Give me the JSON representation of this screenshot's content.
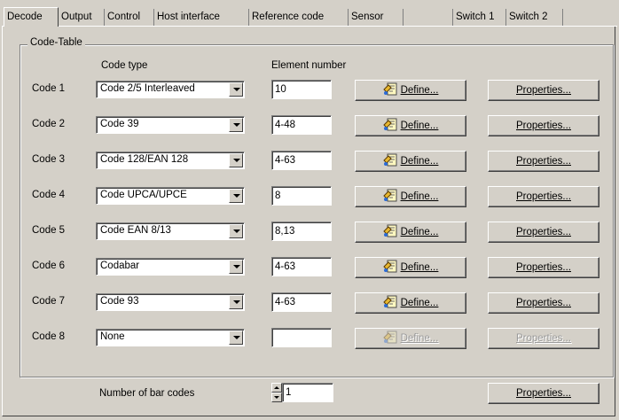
{
  "tabs": [
    {
      "label": "Decode",
      "active": true
    },
    {
      "label": "Output"
    },
    {
      "label": "Control"
    },
    {
      "label": "Host interface"
    },
    {
      "label": "Reference code"
    },
    {
      "label": "Sensor"
    },
    {
      "label": ""
    },
    {
      "label": "Switch 1"
    },
    {
      "label": "Switch 2"
    }
  ],
  "code_table": {
    "title": "Code-Table",
    "col_code_type": "Code type",
    "col_element_number": "Element number",
    "define_label": "Define...",
    "properties_label": "Properties...",
    "rows": [
      {
        "label": "Code 1",
        "code_type": "Code 2/5 Interleaved",
        "element_number": "10",
        "enabled": true
      },
      {
        "label": "Code 2",
        "code_type": "Code 39",
        "element_number": "4-48",
        "enabled": true
      },
      {
        "label": "Code 3",
        "code_type": "Code 128/EAN 128",
        "element_number": "4-63",
        "enabled": true
      },
      {
        "label": "Code 4",
        "code_type": "Code UPCA/UPCE",
        "element_number": "8",
        "enabled": true
      },
      {
        "label": "Code 5",
        "code_type": "Code EAN 8/13",
        "element_number": "8,13",
        "enabled": true
      },
      {
        "label": "Code 6",
        "code_type": "Codabar",
        "element_number": "4-63",
        "enabled": true
      },
      {
        "label": "Code 7",
        "code_type": "Code 93",
        "element_number": "4-63",
        "enabled": true
      },
      {
        "label": "Code 8",
        "code_type": "None",
        "element_number": "",
        "enabled": false
      }
    ]
  },
  "footer": {
    "bar_codes_label": "Number of bar codes",
    "bar_codes_value": "1",
    "properties_label": "Properties..."
  },
  "icons": {
    "define": "define-code-icon",
    "dropdown": "chevron-down-icon"
  },
  "colors": {
    "face": "#d4d0c8",
    "disabled_text": "#9a9a9a"
  }
}
